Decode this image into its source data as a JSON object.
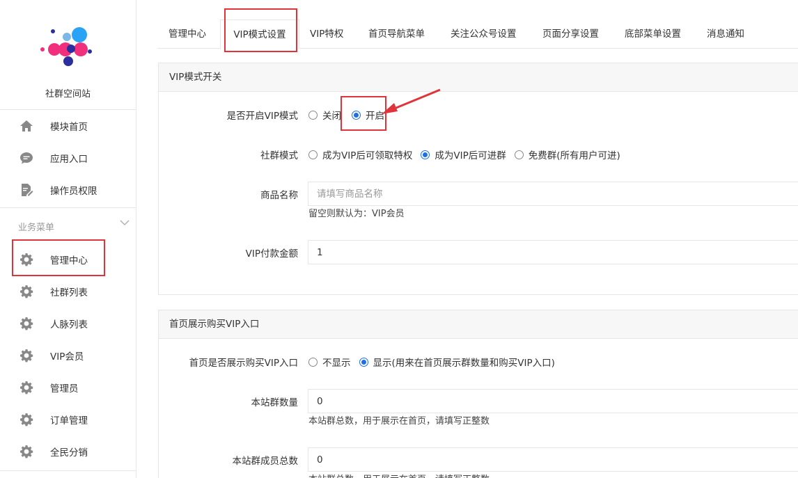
{
  "sidebar": {
    "site_name": "社群空间站",
    "top_items": [
      {
        "label": "模块首页",
        "icon": "home-icon"
      },
      {
        "label": "应用入口",
        "icon": "chat-bubble-icon"
      },
      {
        "label": "操作员权限",
        "icon": "document-edit-icon"
      }
    ],
    "section_title": "业务菜单",
    "business_items": [
      {
        "label": "管理中心",
        "icon": "gear-icon"
      },
      {
        "label": "社群列表",
        "icon": "gear-icon"
      },
      {
        "label": "人脉列表",
        "icon": "gear-icon"
      },
      {
        "label": "VIP会员",
        "icon": "gear-icon"
      },
      {
        "label": "管理员",
        "icon": "gear-icon"
      },
      {
        "label": "订单管理",
        "icon": "gear-icon"
      },
      {
        "label": "全民分销",
        "icon": "gear-icon"
      }
    ]
  },
  "tabs": [
    {
      "label": "管理中心"
    },
    {
      "label": "VIP模式设置",
      "active": true
    },
    {
      "label": "VIP特权"
    },
    {
      "label": "首页导航菜单"
    },
    {
      "label": "关注公众号设置"
    },
    {
      "label": "页面分享设置"
    },
    {
      "label": "底部菜单设置"
    },
    {
      "label": "消息通知"
    }
  ],
  "vip_panel": {
    "title": "VIP模式开关",
    "enable": {
      "label": "是否开启VIP模式",
      "options": [
        "关闭",
        "开启"
      ],
      "selected": "开启"
    },
    "group_mode": {
      "label": "社群模式",
      "options": [
        "成为VIP后可领取特权",
        "成为VIP后可进群",
        "免费群(所有用户可进)"
      ],
      "selected": "成为VIP后可进群"
    },
    "product_name": {
      "label": "商品名称",
      "placeholder": "请填写商品名称",
      "value": "",
      "hint": "留空则默认为：VIP会员"
    },
    "amount": {
      "label": "VIP付款金额",
      "value": "1"
    }
  },
  "home_panel": {
    "title": "首页展示购买VIP入口",
    "show_entry": {
      "label": "首页是否展示购买VIP入口",
      "options": [
        "不显示",
        "显示(用来在首页展示群数量和购买VIP入口)"
      ],
      "selected": "显示(用来在首页展示群数量和购买VIP入口)"
    },
    "group_count": {
      "label": "本站群数量",
      "value": "0",
      "hint": "本站群总数，用于展示在首页，请填写正整数"
    },
    "member_count": {
      "label": "本站群成员总数",
      "value": "0",
      "hint": "本站群总数，用于展示在首页，请填写正整数"
    }
  },
  "colors": {
    "accent": "#1e6ee6",
    "annotation": "#e0343a",
    "logo_blue": "#2aa3f5",
    "logo_pink": "#f0307c",
    "logo_navy": "#2b2f9e"
  }
}
